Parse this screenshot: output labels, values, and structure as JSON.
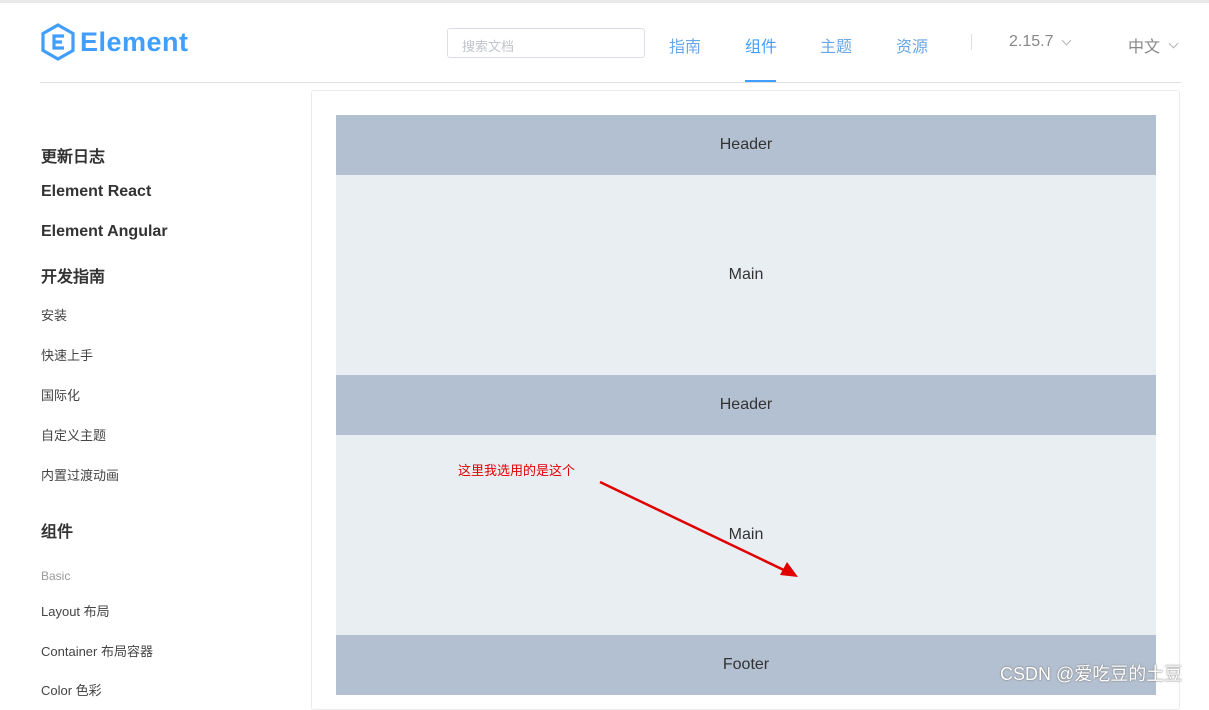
{
  "app": {
    "logo_text": "Element"
  },
  "search": {
    "placeholder": "搜索文档"
  },
  "nav": {
    "items": [
      {
        "label": "指南"
      },
      {
        "label": "组件"
      },
      {
        "label": "主题"
      },
      {
        "label": "资源"
      }
    ],
    "version": "2.15.7",
    "language": "中文"
  },
  "sidebar": {
    "links": [
      "更新日志",
      "Element React",
      "Element Angular"
    ],
    "guide_heading": "开发指南",
    "guide_items": [
      "安装",
      "快速上手",
      "国际化",
      "自定义主题",
      "内置过渡动画"
    ],
    "components_heading": "组件",
    "basic_group": "Basic",
    "component_items": [
      "Layout 布局",
      "Container 布局容器",
      "Color 色彩"
    ]
  },
  "demo": {
    "header1": "Header",
    "main1": "Main",
    "header2": "Header",
    "main2": "Main",
    "footer": "Footer"
  },
  "annotation": {
    "text": "这里我选用的是这个",
    "color": "#e00000"
  },
  "watermark": "CSDN @爱吃豆的土豆",
  "colors": {
    "accent": "#409eff",
    "header_bg": "#b3c0d1",
    "main_bg": "#e9eef3"
  }
}
